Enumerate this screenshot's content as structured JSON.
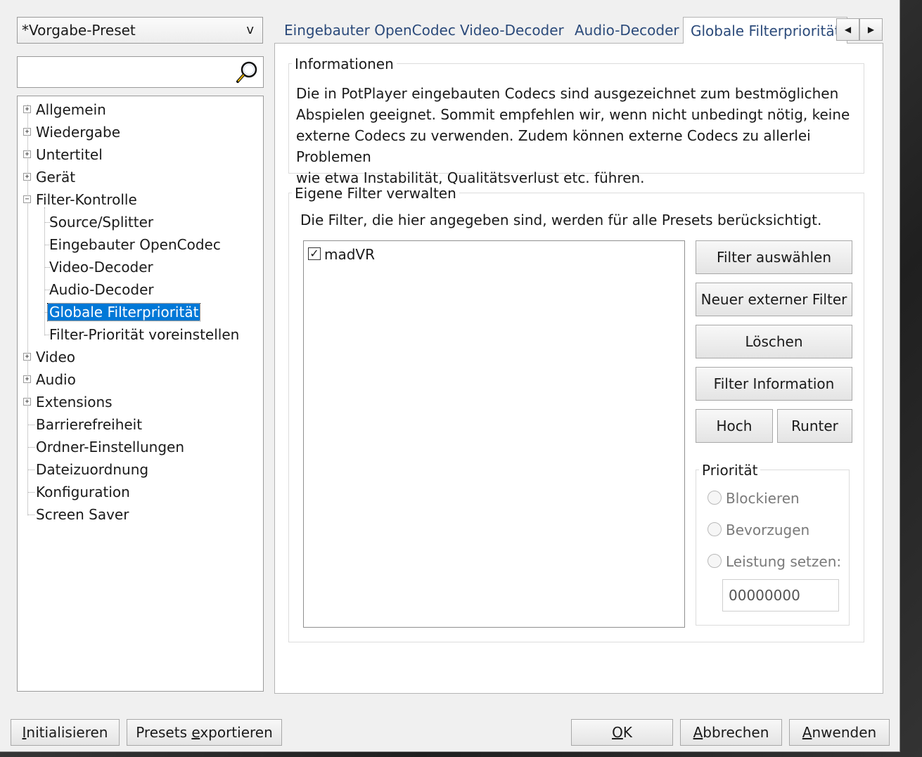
{
  "preset_combo": {
    "value": "*Vorgabe-Preset",
    "arrow": "v"
  },
  "search": {
    "value": "",
    "icon": "magnifier-icon"
  },
  "tree": {
    "items": [
      {
        "label": "Allgemein"
      },
      {
        "label": "Wiedergabe"
      },
      {
        "label": "Untertitel"
      },
      {
        "label": "Gerät"
      },
      {
        "label": "Filter-Kontrolle"
      },
      {
        "label": "Source/Splitter"
      },
      {
        "label": "Eingebauter OpenCodec"
      },
      {
        "label": "Video-Decoder"
      },
      {
        "label": "Audio-Decoder"
      },
      {
        "label": "Globale Filterpriorität"
      },
      {
        "label": "Filter-Priorität voreinstellen"
      },
      {
        "label": "Video"
      },
      {
        "label": "Audio"
      },
      {
        "label": "Extensions"
      },
      {
        "label": "Barrierefreiheit"
      },
      {
        "label": "Ordner-Einstellungen"
      },
      {
        "label": "Dateizuordnung"
      },
      {
        "label": "Konfiguration"
      },
      {
        "label": "Screen Saver"
      }
    ]
  },
  "tabs": [
    {
      "label": "Eingebauter OpenCodec"
    },
    {
      "label": "Video-Decoder"
    },
    {
      "label": "Audio-Decoder"
    },
    {
      "label": "Globale Filterpriorität"
    }
  ],
  "tab_scroll": {
    "left": "◀",
    "right": "▶"
  },
  "info": {
    "legend": "Informationen",
    "lines": [
      "Die in PotPlayer eingebauten Codecs sind ausgezeichnet zum bestmöglichen",
      "Abspielen geeignet. Sommit empfehlen wir, wenn nicht unbedingt nötig, keine",
      "externe Codecs zu verwenden. Zudem können externe Codecs zu allerlei Problemen",
      "wie etwa Instabilität, Qualitätsverlust etc. führen."
    ]
  },
  "filters": {
    "legend": "Eigene Filter verwalten",
    "description": "Die Filter, die hier angegeben sind, werden für alle Presets berücksichtigt.",
    "list": [
      {
        "label": "madVR",
        "checked": true,
        "check_glyph": "✓"
      }
    ],
    "buttons": {
      "select": "Filter auswählen",
      "new_external": "Neuer externer Filter",
      "delete": "Löschen",
      "info": "Filter Information",
      "up": "Hoch",
      "down": "Runter"
    }
  },
  "priority": {
    "legend": "Priorität",
    "options": [
      "Blockieren",
      "Bevorzugen",
      "Leistung setzen:"
    ],
    "merit_value": "00000000"
  },
  "bottom": {
    "initialize": {
      "pre": "",
      "ul": "I",
      "post": "nitialisieren"
    },
    "export": {
      "pre": "Presets ",
      "ul": "e",
      "post": "xportieren"
    },
    "ok": {
      "pre": "",
      "ul": "O",
      "post": "K"
    },
    "cancel": {
      "pre": "",
      "ul": "A",
      "post": "bbrechen"
    },
    "apply": {
      "pre": "",
      "ul": "A",
      "post": "nwenden"
    }
  }
}
